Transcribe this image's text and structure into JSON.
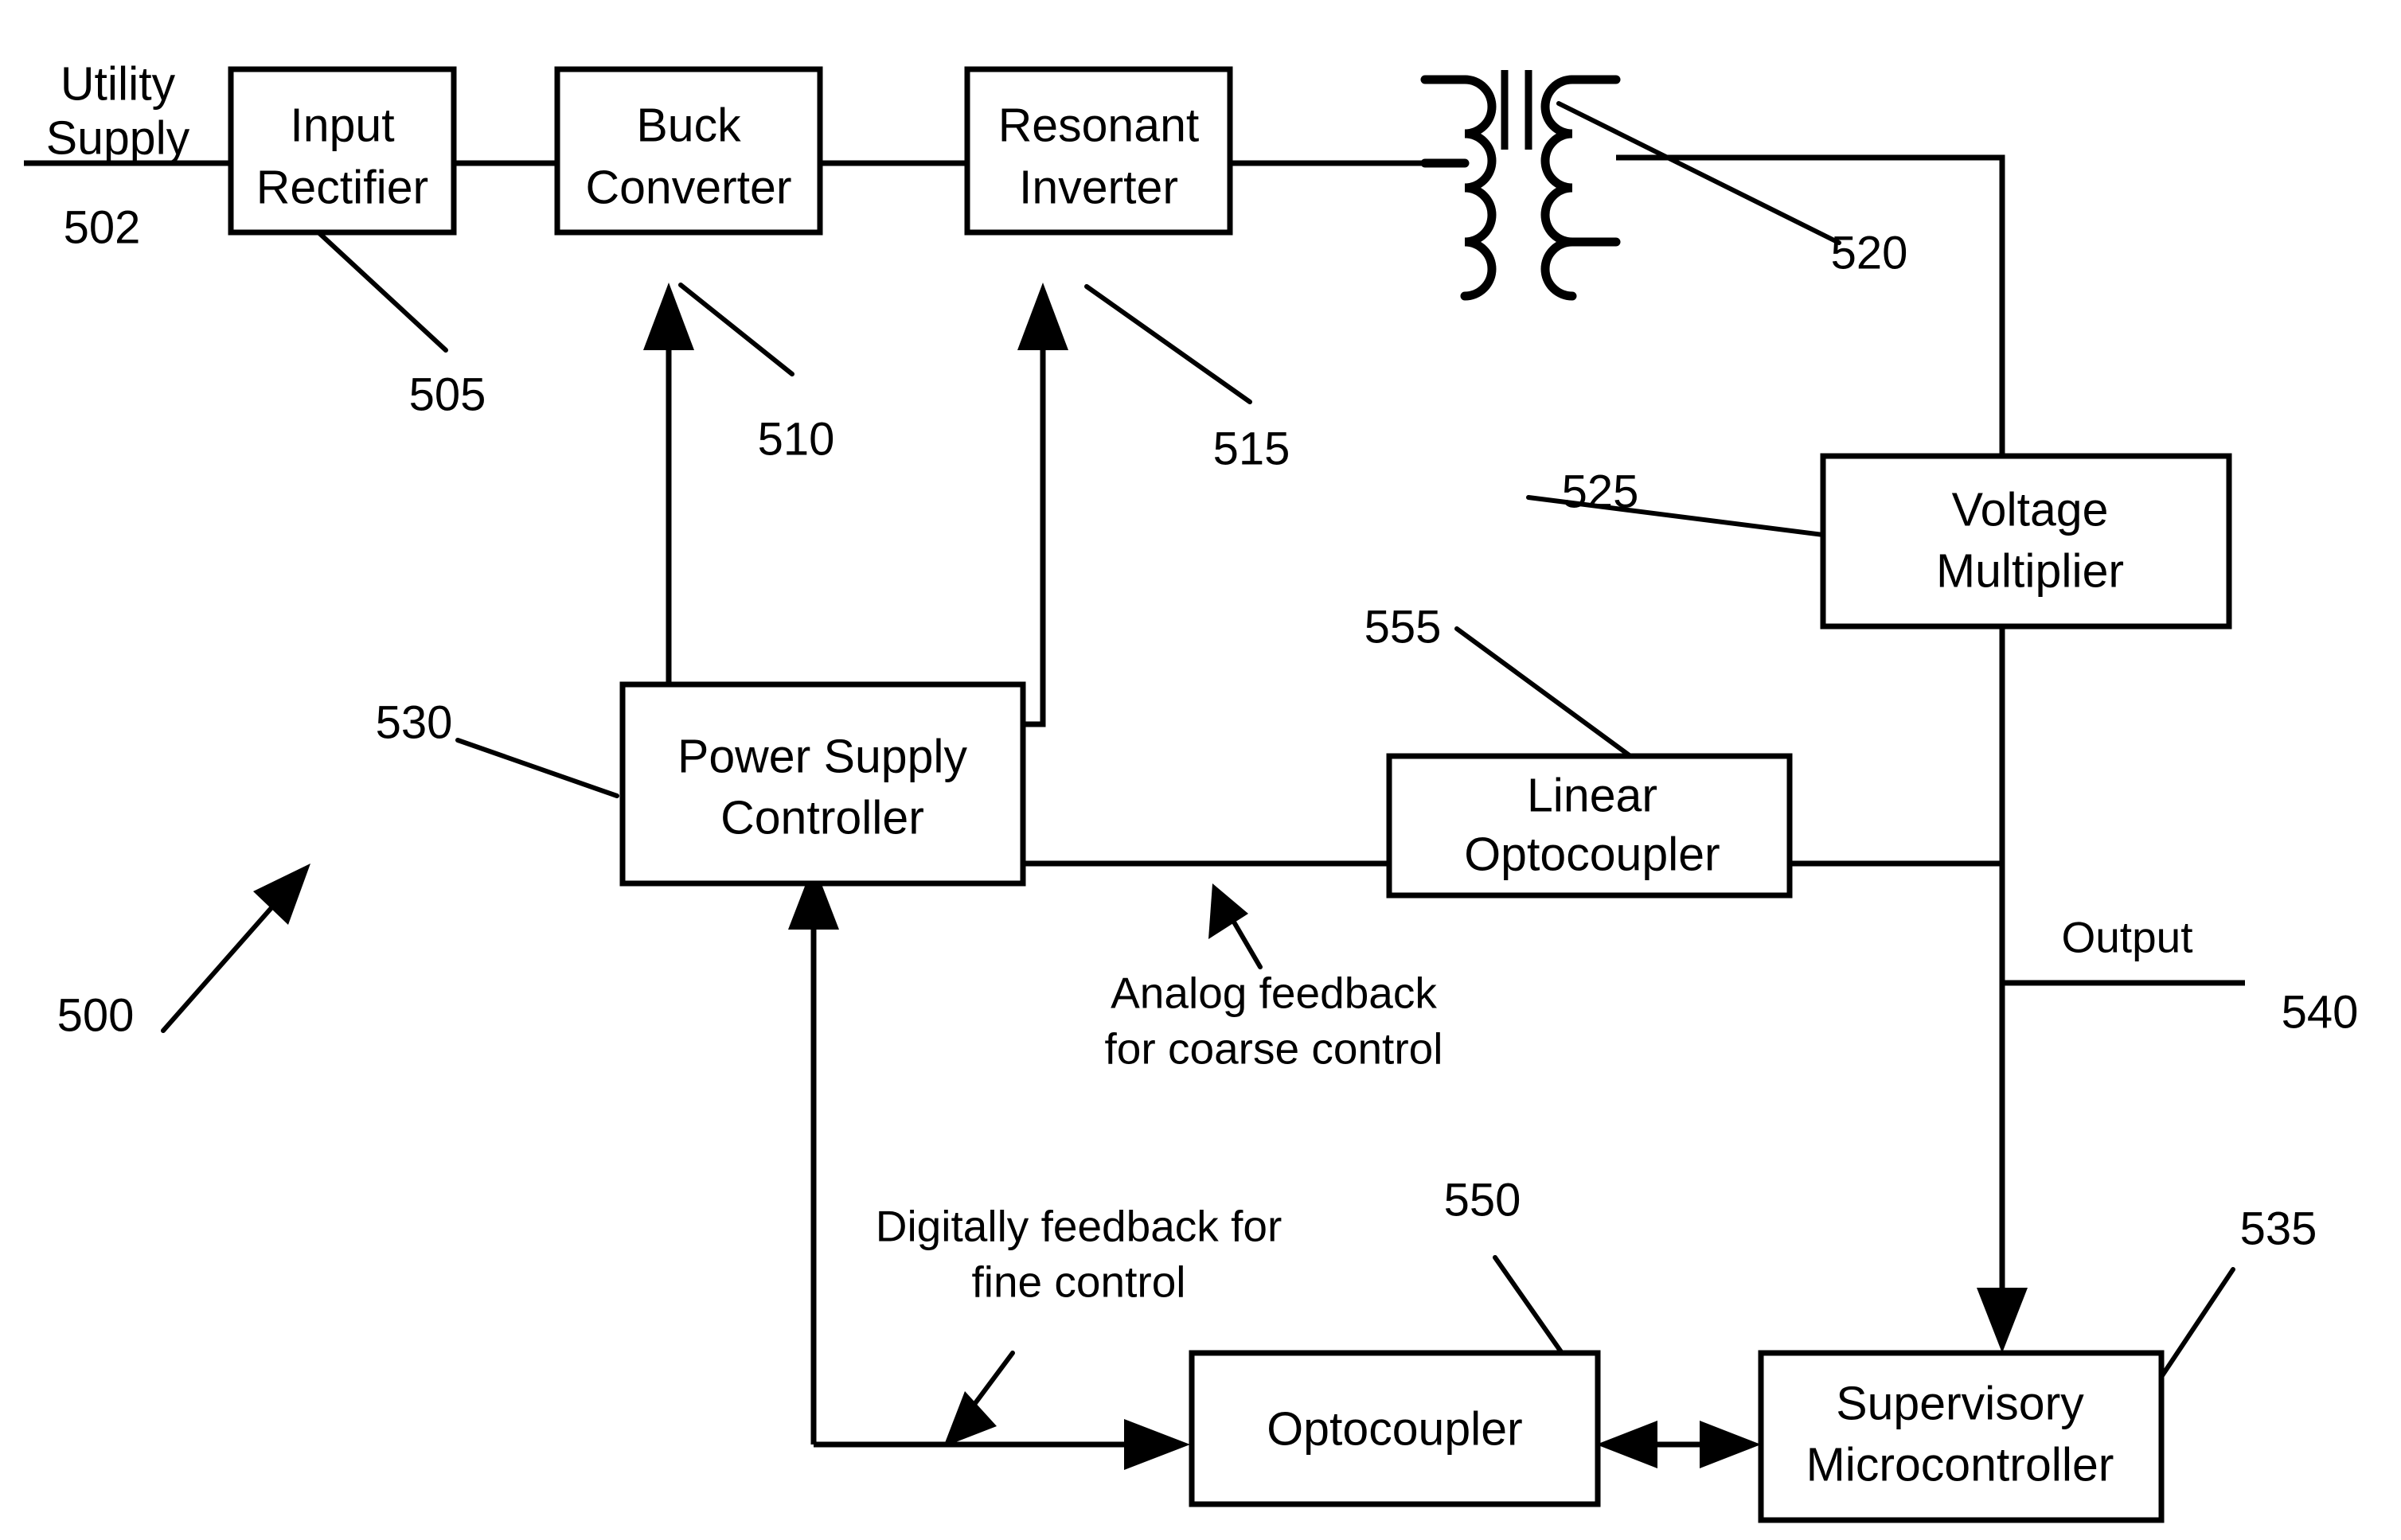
{
  "figure": {
    "type": "patent-block-diagram",
    "reference_numerals": {
      "system": "500",
      "utility_supply": "502",
      "input_rectifier": "505",
      "buck_converter": "510",
      "resonant_inverter": "515",
      "transformer": "520",
      "voltage_multiplier": "525",
      "power_supply_controller": "530",
      "supervisory_microcontroller": "535",
      "output": "540",
      "optocoupler": "550",
      "linear_optocoupler": "555"
    },
    "blocks": [
      {
        "id": "input_rectifier",
        "line1": "Input",
        "line2": "Rectifier",
        "ref": "505"
      },
      {
        "id": "buck_converter",
        "line1": "Buck",
        "line2": "Converter",
        "ref": "510"
      },
      {
        "id": "resonant_inverter",
        "line1": "Resonant",
        "line2": "Inverter",
        "ref": "515"
      },
      {
        "id": "voltage_multiplier",
        "line1": "Voltage",
        "line2": "Multiplier",
        "ref": "525"
      },
      {
        "id": "power_supply_controller",
        "line1": "Power Supply",
        "line2": "Controller",
        "ref": "530"
      },
      {
        "id": "linear_optocoupler",
        "line1": "Linear",
        "line2": "Optocoupler",
        "ref": "555"
      },
      {
        "id": "optocoupler",
        "line1": "Optocoupler",
        "line2": "",
        "ref": "550"
      },
      {
        "id": "supervisory_microcontroller",
        "line1": "Supervisory",
        "line2": "Microcontroller",
        "ref": "535"
      }
    ],
    "labels": {
      "utility_supply_line1": "Utility",
      "utility_supply_line2": "Supply",
      "output": "Output",
      "analog_feedback_line1": "Analog feedback",
      "analog_feedback_line2": "for coarse control",
      "digital_feedback_line1": "Digitally  feedback for",
      "digital_feedback_line2": "fine control"
    },
    "colors": {
      "ink": "#000000",
      "paper": "#ffffff"
    }
  }
}
